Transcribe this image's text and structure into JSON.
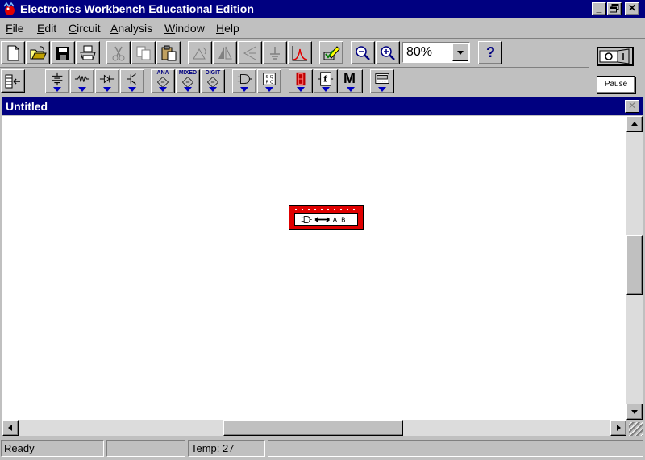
{
  "window": {
    "title": "Electronics Workbench Educational Edition"
  },
  "menu": [
    {
      "label": "File",
      "mnemonic": "F",
      "rest": "ile"
    },
    {
      "label": "Edit",
      "mnemonic": "E",
      "rest": "dit"
    },
    {
      "label": "Circuit",
      "mnemonic": "C",
      "rest": "ircuit"
    },
    {
      "label": "Analysis",
      "mnemonic": "A",
      "rest": "nalysis"
    },
    {
      "label": "Window",
      "mnemonic": "W",
      "rest": "indow"
    },
    {
      "label": "Help",
      "mnemonic": "H",
      "rest": "elp"
    }
  ],
  "toolbar": {
    "zoom_value": "80%",
    "help_label": "?"
  },
  "parts_bin": {
    "analog_label": "ANA",
    "mixed_label": "MIXED",
    "digital_label": "DIGIT",
    "misc_label": "M"
  },
  "controls": {
    "pause_label": "Pause"
  },
  "document": {
    "title": "Untitled"
  },
  "status": {
    "state": "Ready",
    "blank": "",
    "temp": "Temp: 27",
    "extra": ""
  },
  "colors": {
    "title_bg": "#000080",
    "chrome": "#c0c0c0",
    "component_red": "#e00000"
  }
}
